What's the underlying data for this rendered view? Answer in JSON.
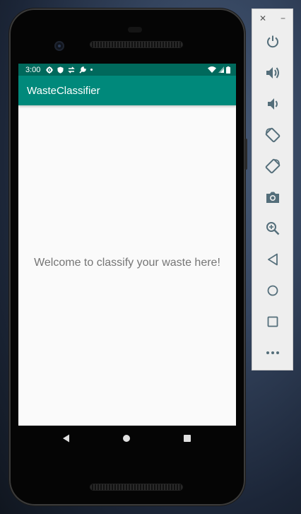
{
  "statusbar": {
    "time": "3:00",
    "left_icons": [
      "gear-icon",
      "shield-icon",
      "sync-icon",
      "wrench-icon",
      "dot-icon"
    ],
    "right_icons": [
      "wifi-icon",
      "signal-icon",
      "battery-icon"
    ]
  },
  "app": {
    "title": "WasteClassifier",
    "welcome_text": "Welcome to classify your waste here!"
  },
  "navbar": {
    "buttons": [
      "back-icon",
      "home-icon",
      "recents-icon"
    ]
  },
  "emulator_toolbar": {
    "window_controls": [
      "close-icon",
      "minimize-icon"
    ],
    "items": [
      "power-icon",
      "volume-up-icon",
      "volume-down-icon",
      "rotate-left-icon",
      "rotate-right-icon",
      "camera-icon",
      "zoom-icon",
      "back-icon",
      "home-icon",
      "overview-icon",
      "more-icon"
    ]
  },
  "colors": {
    "statusbar": "#00695c",
    "appbar": "#00897b",
    "screen_bg": "#fafafa",
    "welcome_text": "#757575",
    "toolbar_bg": "#eeeeee",
    "toolbar_icon": "#546e7a"
  }
}
